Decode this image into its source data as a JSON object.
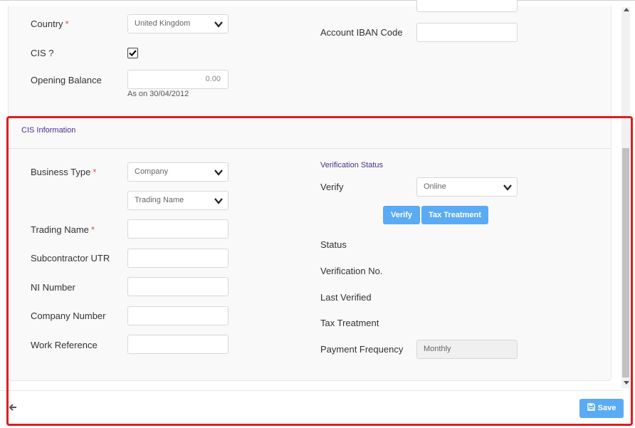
{
  "top": {
    "country": {
      "label": "Country",
      "required": "*",
      "value": "United Kingdom"
    },
    "cis": {
      "label": "CIS ?",
      "checked": true
    },
    "opening_balance": {
      "label": "Opening Balance",
      "value": "0.00",
      "note": "As on 30/04/2012"
    },
    "iban": {
      "label": "Account IBAN Code",
      "value": ""
    }
  },
  "cis_section": {
    "title": "CIS Information",
    "left": {
      "business_type": {
        "label": "Business Type",
        "required": "*",
        "value": "Company"
      },
      "trading_name_select": {
        "value": "Trading Name"
      },
      "trading_name": {
        "label": "Trading Name",
        "required": "*",
        "value": ""
      },
      "subcontractor_utr": {
        "label": "Subcontractor UTR",
        "value": ""
      },
      "ni_number": {
        "label": "NI Number",
        "value": ""
      },
      "company_number": {
        "label": "Company Number",
        "value": ""
      },
      "work_reference": {
        "label": "Work Reference",
        "value": ""
      }
    },
    "right": {
      "heading": "Verification Status",
      "verify": {
        "label": "Verify",
        "value": "Online"
      },
      "buttons": {
        "verify": "Verify",
        "tax_treatment": "Tax Treatment"
      },
      "status": {
        "label": "Status"
      },
      "verification_no": {
        "label": "Verification No."
      },
      "last_verified": {
        "label": "Last Verified"
      },
      "tax_treatment": {
        "label": "Tax Treatment"
      },
      "payment_frequency": {
        "label": "Payment Frequency",
        "value": "Monthly"
      }
    }
  },
  "footer": {
    "save_label": "Save"
  },
  "colors": {
    "accent": "#5aabf3",
    "section_title": "#4b2f8a",
    "required": "#d9534f",
    "highlight": "#dd1e1e"
  }
}
